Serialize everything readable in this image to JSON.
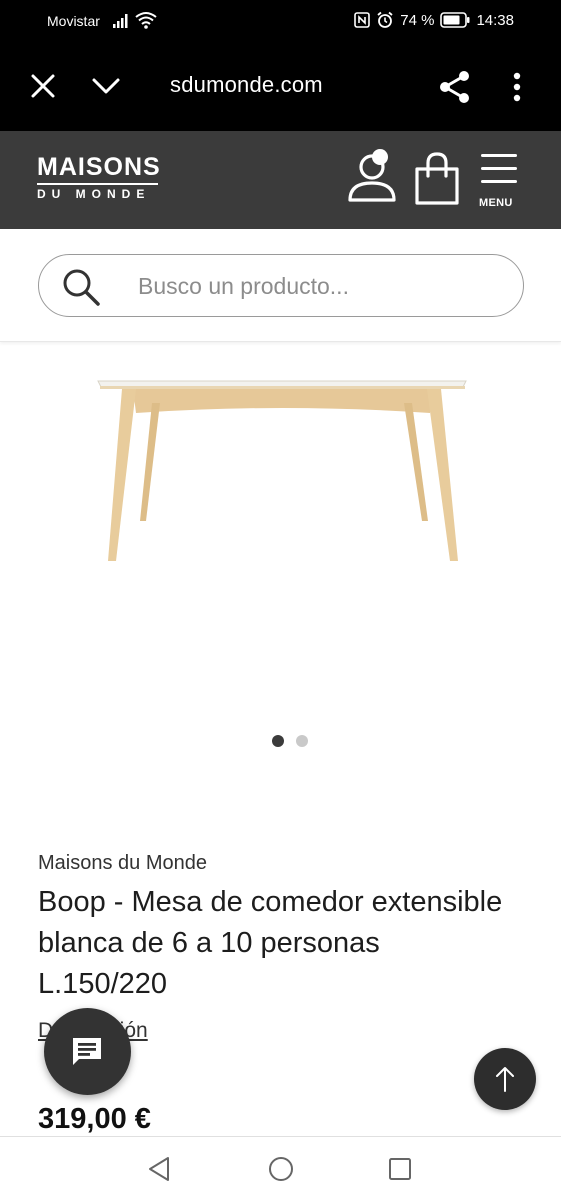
{
  "status_bar": {
    "carrier": "Movistar",
    "battery": "74 %",
    "time": "14:38",
    "icons": [
      "signal-icon",
      "wifi-icon",
      "nfc-icon",
      "alarm-icon",
      "battery-icon"
    ]
  },
  "browser": {
    "url": "sdumonde.com",
    "icons": [
      "close-icon",
      "chevron-down-icon",
      "share-icon",
      "more-vert-icon"
    ]
  },
  "header": {
    "logo_line1": "MAISONS",
    "logo_line2": "DU MONDE",
    "menu_label": "MENU",
    "icons": [
      "account-icon",
      "shopping-bag-icon",
      "hamburger-icon"
    ]
  },
  "search": {
    "placeholder": "Busco un producto..."
  },
  "carousel": {
    "total": 2,
    "active": 1
  },
  "product": {
    "brand": "Maisons du Monde",
    "title": "Boop - Mesa de comedor extensible blanca de 6 a 10 personas L.150/220",
    "description_link": "Descripción",
    "price": "319,00 €"
  },
  "floating": {
    "icons": [
      "chat-icon",
      "arrow-up-icon"
    ]
  },
  "nav": {
    "icons": [
      "back-triangle-icon",
      "home-circle-icon",
      "recents-square-icon"
    ]
  },
  "colors": {
    "header_bg": "#3b3b3b",
    "browser_bg": "#000000",
    "wood": "#e3c595",
    "table_top": "#f7f7f5"
  }
}
